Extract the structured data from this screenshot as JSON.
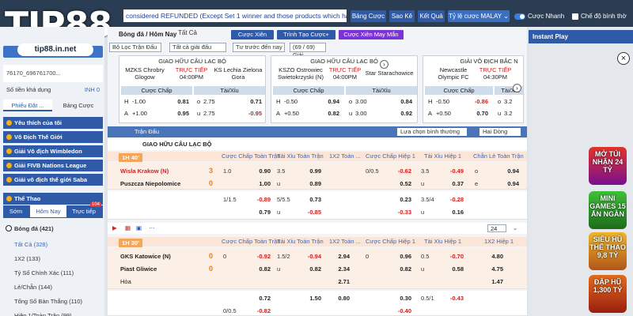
{
  "brand": {
    "logo": "TIP88",
    "url": "tip88.in.net"
  },
  "top": {
    "ticker": "considered REFUNDED (Except Set 1 winner and those products which have",
    "bang_cuoc": "Bảng Cược",
    "sao_ke": "Sao Kê",
    "ket_qua": "Kết Quả",
    "ty_le": "Tỷ lệ cược MALAY ⌄",
    "cuoc_nhanh": "Cược Nhanh",
    "che_do": "Chế độ bình thờ"
  },
  "sidebar": {
    "account": "76170_696761700...",
    "balance_label": "Số tiền khả dụng",
    "balance": "INH 0",
    "tab1": "Phiếu Đặt ...",
    "tab2": "Bảng Cược",
    "cats": [
      "Yêu thích của tôi",
      "Vô Địch Thế Giới",
      "Giải Vô địch Wimbledon",
      "Giải FIVB Nations League",
      "Giải vô địch thế giới Saba",
      "Thể Thao"
    ],
    "sport_tabs": [
      "Sớm",
      "Hôm Nay",
      "Trực tiếp"
    ],
    "live_count": "104",
    "sport": "Bóng đá",
    "sport_count": "(421)",
    "subs": [
      "Tất Cả (328)",
      "1X2 (133)",
      "Tỷ Số Chính Xác (111)",
      "Lẻ/Chẵn (144)",
      "Tổng Số Bàn Thắng (110)",
      "Hiệp 1/Toàn Trận (99)"
    ]
  },
  "main": {
    "crumb": "Bóng đá / Hôm Nay",
    "filter": "Tất Cả",
    "btn1": "Cược Xiên",
    "btn2": "Trình Tạo Cược+",
    "btn3": "Cược Xiên May Mắn",
    "sel1": "Bộ Lọc Trận Đấu",
    "sel2": "Tất cả giải đấu",
    "sel3": "Tư trước đến nay",
    "sel4": "(69 / 69) Giải",
    "cards": [
      {
        "league": "GIAO HỮU CÂU LẠC BỘ",
        "home": "MZKS Chrobry Glogow",
        "away": "KS Lechia Zielona Gora",
        "status": "TRỰC TIẾP",
        "time": "04:00PM",
        "h1": "-1.00",
        "h1o": "0.81",
        "h2": "2.75",
        "h2o": "0.71",
        "a1": "+1.00",
        "a1o": "0.95",
        "a2": "2.75",
        "a2o": "-0.95"
      },
      {
        "league": "GIAO HỮU CÂU LẠC BỘ",
        "home": "KSZO Ostrowiec Swietokrzyski (N)",
        "away": "Star Starachowice",
        "status": "TRỰC TIẾP",
        "time": "04:00PM",
        "h1": "-0.50",
        "h1o": "0.94",
        "h2": "3.00",
        "h2o": "0.84",
        "a1": "+0.50",
        "a1o": "0.82",
        "a2": "3.00",
        "a2o": "0.92"
      },
      {
        "league": "GIẢI VÔ ĐỊCH BẮC N",
        "home": "Newcastle Olympic FC",
        "away": "",
        "status": "TRỰC TIẾP",
        "time": "04:30PM",
        "h1": "-0.50",
        "h1o": "-0.86",
        "h2": "3.2",
        "h2o": "",
        "a1": "+0.50",
        "a1o": "0.70",
        "a2": "3.2",
        "a2o": ""
      }
    ],
    "hdr_cuoc_chap": "Cược Chấp",
    "hdr_tai_xiu": "Tài/Xỉu",
    "label_h": "H",
    "label_a": "A",
    "label_o": "o",
    "label_u": "u",
    "tran_dau": "Trận Đấu",
    "sort": "Lựa chọn bình thường",
    "cols_sel": "Hai Dòng",
    "league_row": "GIAO HỮU CÂU LẠC BỘ",
    "cols": [
      "Cược Chấp Toàn Trận",
      "Tài Xỉu Toàn Trận",
      "1X2 Toàn ...",
      "Cược Chấp Hiệp 1",
      "Tài Xỉu Hiệp 1",
      "Chẵn Lẻ Toàn Trận"
    ],
    "cols2": [
      "Cược Chấp Toàn Trận",
      "Tài Xỉu Toàn Trận",
      "1X2 Toàn ...",
      "Cược Chấp Hiệp 1",
      "Tài Xỉu Hiệp 1",
      "1X2 Hiệp 1"
    ],
    "m1": {
      "tag": "1H 40'",
      "home": "Wisla Krakow (N)",
      "away": "Puszcza Niepolomice",
      "hs": "3",
      "as": "0",
      "r1": [
        "1.0",
        "0.90",
        "3.5",
        "0.99",
        "",
        "0/0.5",
        "-0.62",
        "3.5",
        "-0.49",
        "o",
        "0.94"
      ],
      "r2": [
        "",
        "1.00",
        "u",
        "0.89",
        "",
        "",
        "0.52",
        "u",
        "0.37",
        "e",
        "0.94"
      ],
      "r3": [
        "1/1.5",
        "-0.89",
        "5/5.5",
        "0.73",
        "",
        "",
        "0.23",
        "3.5/4",
        "-0.28",
        "",
        ""
      ],
      "r4": [
        "",
        "0.79",
        "u",
        "-0.85",
        "",
        "",
        "-0.33",
        "u",
        "0.16",
        "",
        ""
      ]
    },
    "page_sel": "24",
    "m2": {
      "tag": "1H 30'",
      "home": "GKS Katowice (N)",
      "away": "Piast Gliwice",
      "draw": "Hòa",
      "hs": "0",
      "as": "0",
      "r1": [
        "0",
        "-0.92",
        "1.5/2",
        "-0.94",
        "2.94",
        "0",
        "0.96",
        "0.5",
        "-0.70",
        "4.80"
      ],
      "r2": [
        "",
        "0.82",
        "u",
        "0.82",
        "2.34",
        "",
        "0.82",
        "u",
        "0.58",
        "4.75"
      ],
      "r3": [
        "",
        "",
        "",
        "",
        "2.71",
        "",
        "",
        "",
        "",
        "1.47"
      ],
      "r4": [
        "",
        "0.72",
        "",
        "1.50",
        "0.80",
        "",
        "0.30",
        "0.5/1",
        "-0.43",
        ""
      ],
      "r5": [
        "0/0.5",
        "-0.82",
        "",
        "",
        "",
        "",
        "-0.40",
        "",
        ""
      ]
    }
  },
  "right": {
    "instant": "Instant Play",
    "promos": [
      "MỞ TÚI NHẬN 24 TỶ",
      "MINI GAMES 15 ẤN NGÀN",
      "SIÊU HŨ THỂ THAO 9,8 TỶ",
      "ĐẬP HŨ 1,300 TỶ"
    ]
  }
}
